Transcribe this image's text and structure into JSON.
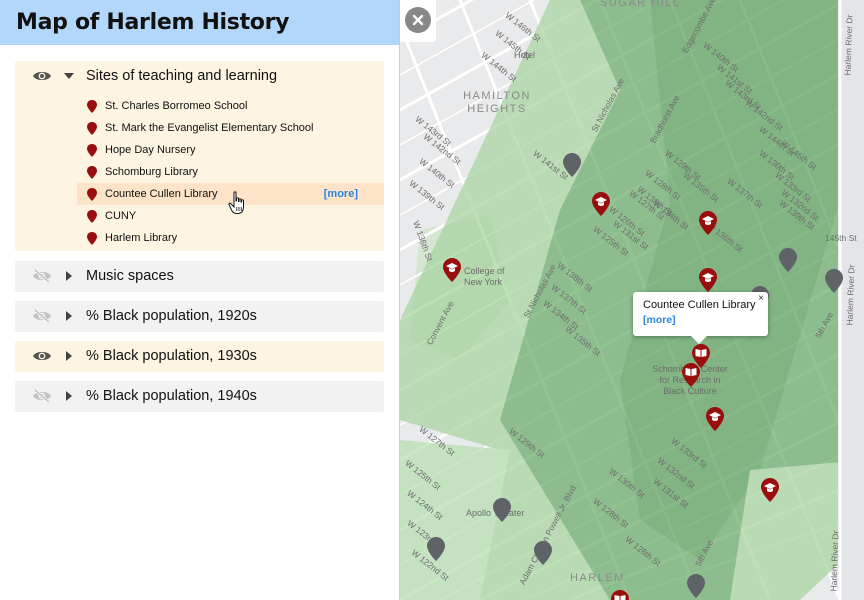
{
  "app": {
    "title": "Map of Harlem History"
  },
  "layers": [
    {
      "name": "Sites of teaching and learning",
      "visible": true,
      "expanded": true,
      "sites": [
        "St. Charles Borromeo School",
        "St. Mark the Evangelist Elementary School",
        "Hope Day Nursery",
        "Schomburg Library",
        "Countee Cullen Library",
        "CUNY",
        "Harlem Library"
      ],
      "more_label": "[more]"
    },
    {
      "name": "Music spaces",
      "visible": false
    },
    {
      "name": "% Black population, 1920s",
      "visible": false
    },
    {
      "name": "% Black population, 1930s",
      "visible": true
    },
    {
      "name": "% Black population, 1940s",
      "visible": false
    }
  ],
  "popup": {
    "title": "Countee Cullen Library",
    "more": "[more]",
    "close": "×"
  },
  "map": {
    "area_labels": [
      "SUGAR HILL",
      "HAMILTON HEIGHTS",
      "HARLEM"
    ],
    "place_labels": [
      "Hotel",
      "College of New York",
      "Schomburg Center for Research in Black Culture",
      "Apollo Theater"
    ],
    "street_labels": [
      "W 146th St",
      "W 145th St",
      "W 144th St",
      "W 143rd St",
      "W 142nd St",
      "W 141st St",
      "W 140th St",
      "W 139th St",
      "W 138th St",
      "W 137th St",
      "W 136th St",
      "W 135th St",
      "W 134th St",
      "W 133rd St",
      "W 132nd St",
      "W 131st St",
      "W 130th St",
      "W 129th St",
      "W 128th St",
      "W 127th St",
      "W 126th St",
      "W 125th St",
      "W 124th St",
      "W 123rd St",
      "W 122nd St",
      "W 145th St",
      "W 144th St",
      "W 143rd St",
      "W 142nd St",
      "W 141st St",
      "W 140th St",
      "W 139th St",
      "W 138th St",
      "W 137th St",
      "W 136th St",
      "W 135th St",
      "W 134th St",
      "W 133rd St",
      "W 132nd St",
      "W 131st St",
      "W 130th St",
      "W 129th St",
      "W 128th St",
      "W 127th St",
      "W 126th St",
      "W 125th St",
      "St Nicholas Ave",
      "Edgecombe Ave",
      "Bradhurst Ave",
      "Convent Ave",
      "St Nicholas Ave",
      "Adam Clayton Powell Jr. Blvd",
      "5th Ave",
      "5th Ave",
      "Harlem River Dr",
      "Harlem River Dr",
      "Harlem River Dr",
      "145th St"
    ]
  },
  "colors": {
    "header_bg": "#b3d7fb",
    "active_layer_bg": "#fdf4e1",
    "inactive_layer_bg": "#f2f2f2",
    "highlight_row": "#fde3c7",
    "pin_red": "#9b0e0e",
    "link_blue": "#2a86e0",
    "map_green_dark": "#85bf85",
    "map_green_light": "#b5dfae",
    "map_gray_pin": "#5f6368"
  },
  "icons": {
    "visible": "eye-icon",
    "hidden": "eye-slash-icon",
    "expanded": "caret-down-icon",
    "collapsed": "caret-right-icon",
    "site": "map-pin-icon",
    "school_marker": "mortarboard-marker",
    "library_marker": "book-marker",
    "music_marker": "gray-marker"
  }
}
